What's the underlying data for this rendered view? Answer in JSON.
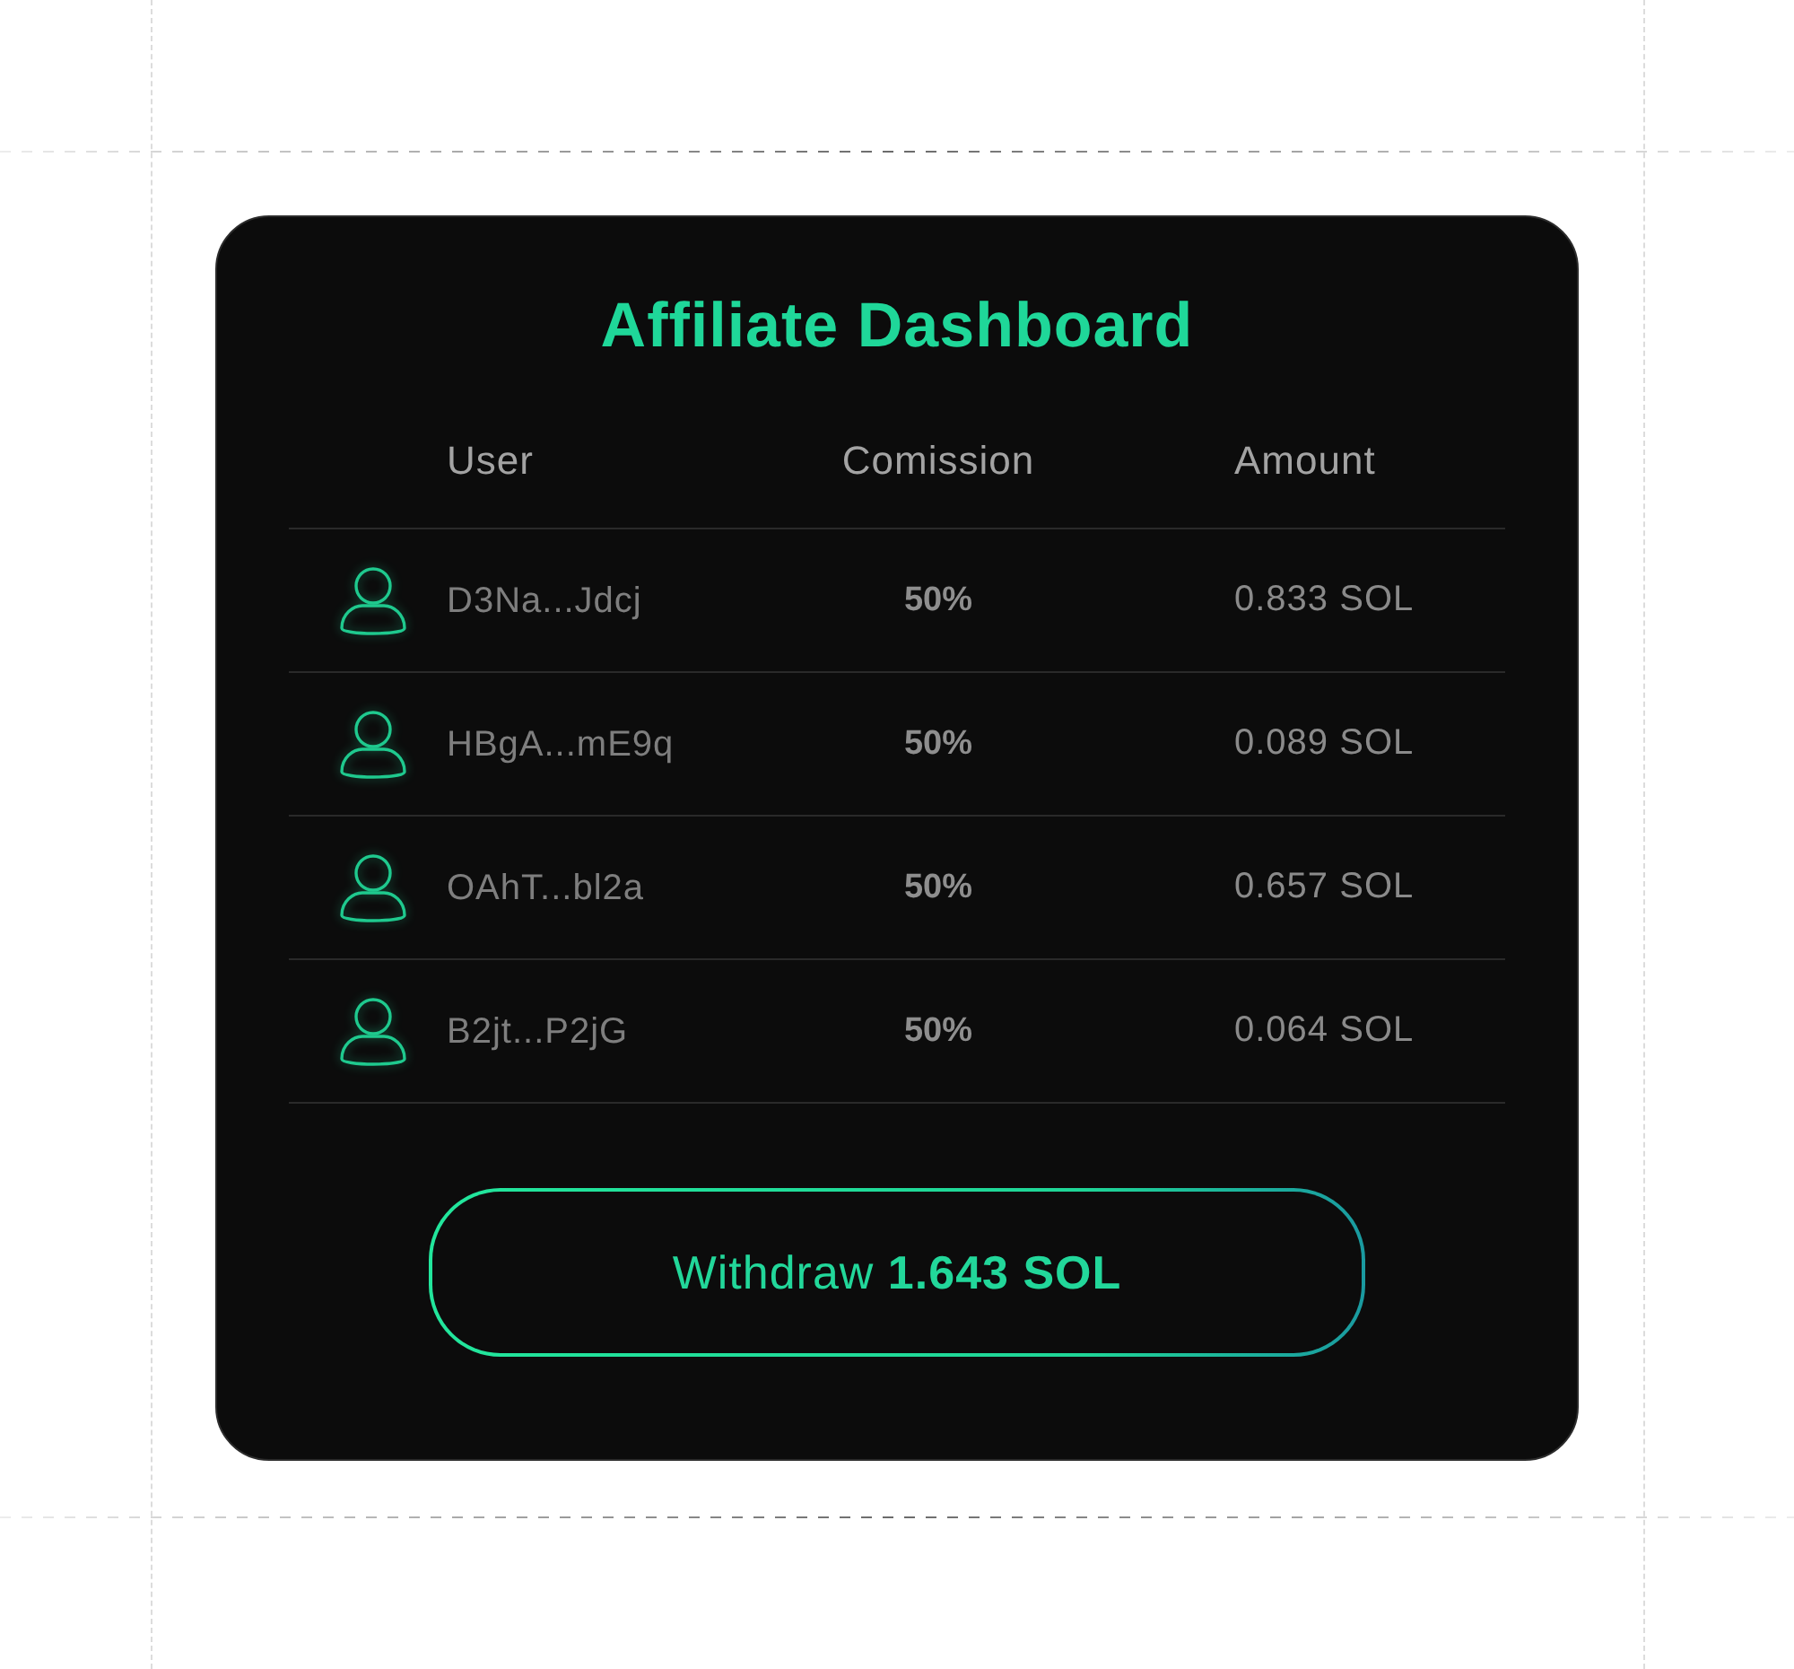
{
  "title": "Affiliate Dashboard",
  "table": {
    "columns": [
      "User",
      "Comission",
      "Amount"
    ],
    "rows": [
      {
        "user": "D3Na...Jdcj",
        "commission": "50%",
        "amount": "0.833 SOL"
      },
      {
        "user": "HBgA...mE9q",
        "commission": "50%",
        "amount": "0.089 SOL"
      },
      {
        "user": "OAhT...bl2a",
        "commission": "50%",
        "amount": "0.657 SOL"
      },
      {
        "user": "B2jt...P2jG",
        "commission": "50%",
        "amount": "0.064 SOL"
      }
    ]
  },
  "withdraw_button": {
    "label": "Withdraw **1.643 SOL**"
  }
}
